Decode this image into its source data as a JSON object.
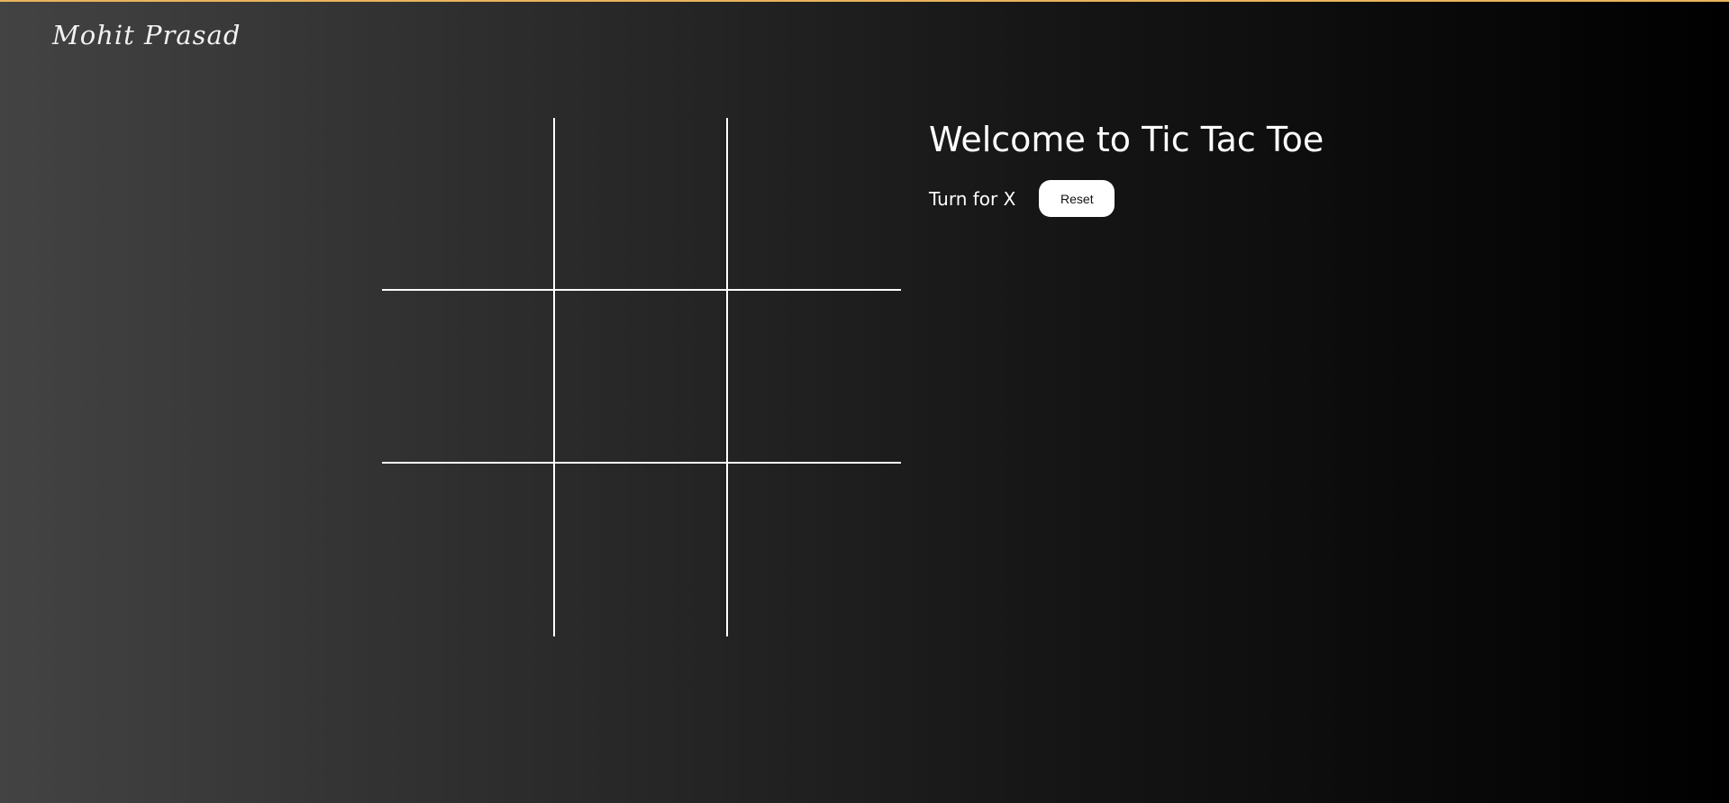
{
  "header": {
    "logo_text": "Mohit Prasad"
  },
  "game": {
    "title": "Welcome to Tic Tac Toe",
    "turn_text": "Turn for X",
    "reset_label": "Reset",
    "board": [
      "",
      "",
      "",
      "",
      "",
      "",
      "",
      "",
      ""
    ]
  },
  "colors": {
    "accent_bar": "#e8b45c",
    "grid_lines": "#ffffff",
    "button_bg": "#ffffff"
  }
}
